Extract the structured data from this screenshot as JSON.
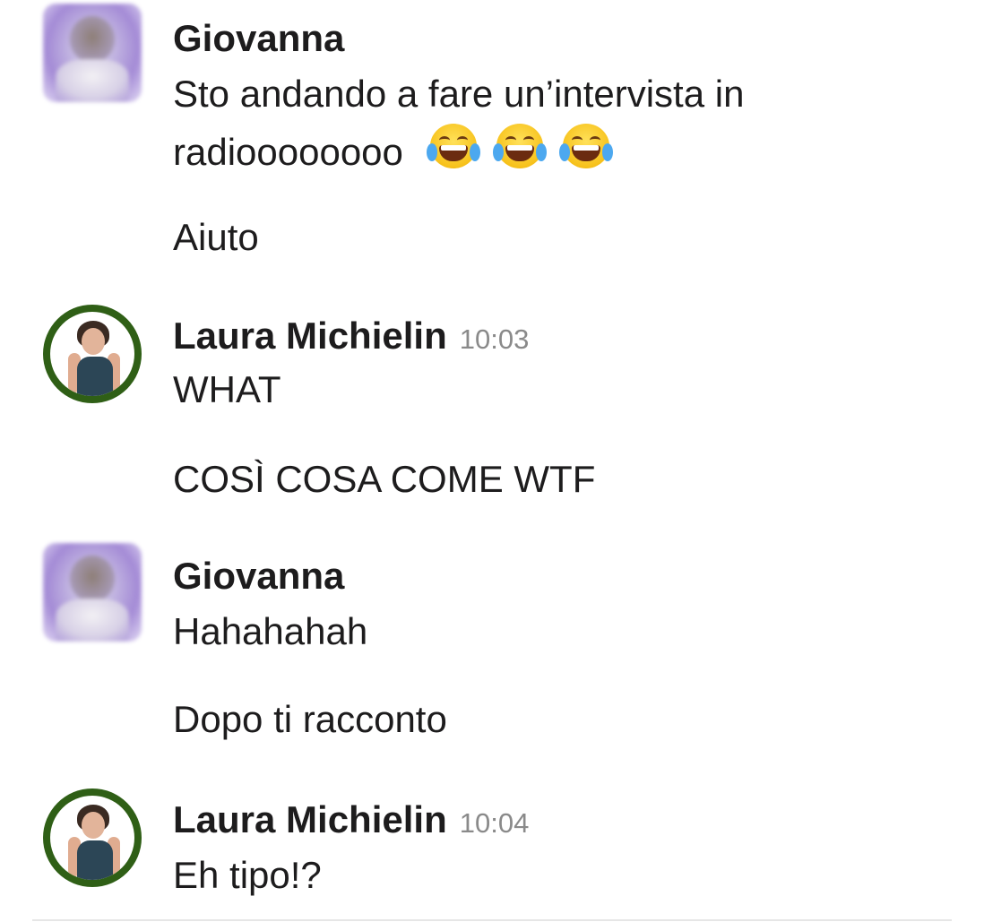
{
  "messages": [
    {
      "author": "Giovanna",
      "time": "",
      "lines": [
        "Sto andando a fare un’intervista in",
        "radioooooooo",
        "Aiuto"
      ],
      "emoji": [
        "face-with-tears-of-joy-emoji",
        "face-with-tears-of-joy-emoji",
        "face-with-tears-of-joy-emoji"
      ]
    },
    {
      "author": "Laura Michielin",
      "time": "10:03",
      "lines": [
        "WHAT",
        "COSÌ COSA COME WTF"
      ]
    },
    {
      "author": "Giovanna",
      "time": "",
      "lines": [
        "Hahahahah",
        "Dopo ti racconto"
      ]
    },
    {
      "author": "Laura Michielin",
      "time": "10:04",
      "lines": [
        "Eh tipo!?"
      ]
    }
  ],
  "colors": {
    "avatar_ring": "#2f5f16",
    "timestamp": "#8a8a8a",
    "text": "#1d1c1d"
  }
}
